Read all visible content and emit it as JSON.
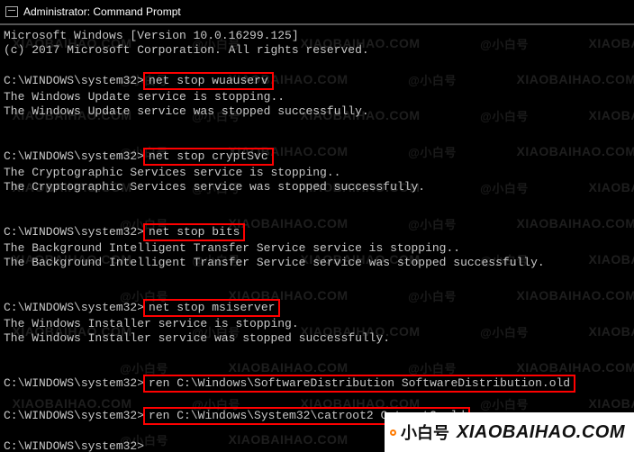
{
  "window": {
    "title": "Administrator: Command Prompt"
  },
  "watermark": {
    "url": "XIAOBAIHAO.COM",
    "alt": "@小白号",
    "rows": 12,
    "cols": 5
  },
  "brand": {
    "cn": "小白号",
    "url": "XIAOBAIHAO.COM"
  },
  "lines": {
    "l01": "Microsoft Windows [Version 10.0.16299.125]",
    "l02": "(c) 2017 Microsoft Corporation. All rights reserved.",
    "l03": "",
    "p1": "C:\\WINDOWS\\system32>",
    "c1": "net stop wuauserv",
    "l05": "The Windows Update service is stopping..",
    "l06": "The Windows Update service was stopped successfully.",
    "l07": "",
    "l08": "",
    "p2": "C:\\WINDOWS\\system32>",
    "c2": "net stop cryptSvc",
    "l10": "The Cryptographic Services service is stopping..",
    "l11": "The Cryptographic Services service was stopped successfully.",
    "l12": "",
    "l13": "",
    "p3": "C:\\WINDOWS\\system32>",
    "c3": "net stop bits",
    "l15": "The Background Intelligent Transfer Service service is stopping..",
    "l16": "The Background Intelligent Transfer Service service was stopped successfully.",
    "l17": "",
    "l18": "",
    "p4": "C:\\WINDOWS\\system32>",
    "c4": "net stop msiserver",
    "l20": "The Windows Installer service is stopping.",
    "l21": "The Windows Installer service was stopped successfully.",
    "l22": "",
    "l23": "",
    "p5": "C:\\WINDOWS\\system32>",
    "c5": "ren C:\\Windows\\SoftwareDistribution SoftwareDistribution.old",
    "l25": "",
    "p6": "C:\\WINDOWS\\system32>",
    "c6": "ren C:\\Windows\\System32\\catroot2 Catroot2.old",
    "l27": "",
    "p7": "C:\\WINDOWS\\system32>"
  }
}
